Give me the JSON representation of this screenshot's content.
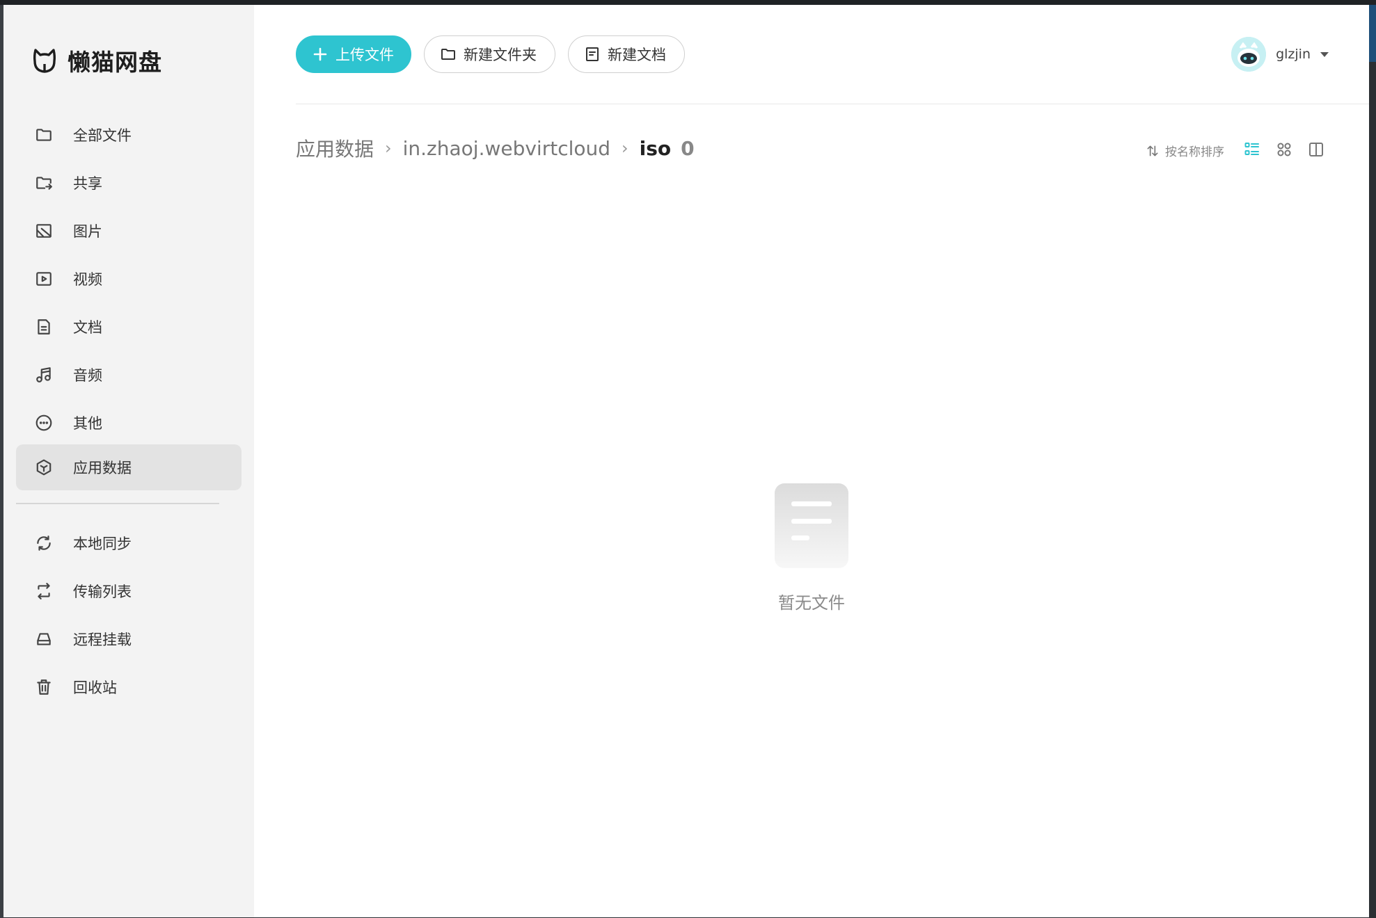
{
  "app": {
    "name": "懒猫网盘"
  },
  "sidebar": {
    "items": [
      {
        "label": "全部文件",
        "icon": "folder-icon"
      },
      {
        "label": "共享",
        "icon": "shared-folder-icon"
      },
      {
        "label": "图片",
        "icon": "image-icon"
      },
      {
        "label": "视频",
        "icon": "video-icon"
      },
      {
        "label": "文档",
        "icon": "document-icon"
      },
      {
        "label": "音频",
        "icon": "music-icon"
      },
      {
        "label": "其他",
        "icon": "more-icon"
      },
      {
        "label": "应用数据",
        "icon": "cube-icon",
        "active": true
      },
      {
        "label": "本地同步",
        "icon": "sync-icon"
      },
      {
        "label": "传输列表",
        "icon": "transfer-icon"
      },
      {
        "label": "远程挂载",
        "icon": "drive-icon"
      },
      {
        "label": "回收站",
        "icon": "trash-icon"
      }
    ]
  },
  "toolbar": {
    "upload_label": "上传文件",
    "new_folder_label": "新建文件夹",
    "new_doc_label": "新建文档"
  },
  "user": {
    "name": "glzjin"
  },
  "breadcrumb": {
    "items": [
      "应用数据",
      "in.zhaoj.webvirtcloud"
    ],
    "current": "iso",
    "count": "0"
  },
  "sort": {
    "label": "按名称排序"
  },
  "views": {
    "active": "list"
  },
  "empty": {
    "text": "暂无文件"
  },
  "colors": {
    "accent": "#2ec4d0",
    "sidebar_bg": "#f3f3f3"
  }
}
